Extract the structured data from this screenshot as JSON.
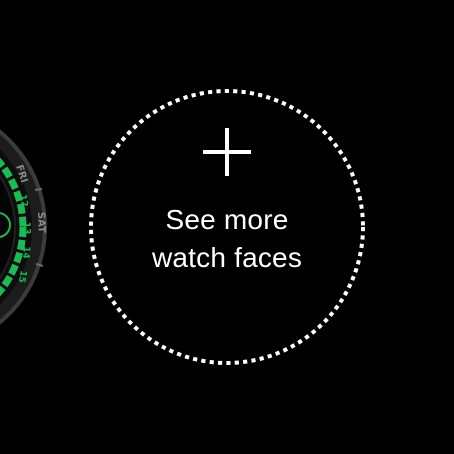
{
  "previous_face": {
    "day_labels": [
      "FRI",
      "SAT"
    ],
    "ring_numbers": [
      "12",
      "13",
      "14",
      "15"
    ],
    "accent_color": "#1db954"
  },
  "add_face": {
    "icon": "plus-icon",
    "label_line1": "See more",
    "label_line2": "watch faces"
  }
}
